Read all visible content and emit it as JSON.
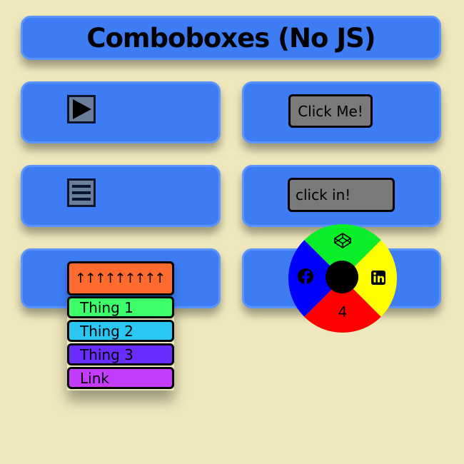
{
  "title": "Comboboxes (No JS)",
  "cards": {
    "play_icon": "play-icon",
    "menu_icon": "hamburger-menu-icon",
    "button_label": "Click Me!",
    "input_placeholder": "click in!"
  },
  "combobox": {
    "toggle_label": "↑↑↑↑↑↑↑↑↑",
    "items": [
      {
        "label": "Thing 1",
        "color": "#3dff6a"
      },
      {
        "label": "Thing 2",
        "color": "#29c7f2"
      },
      {
        "label": "Thing 3",
        "color": "#6a2dff"
      },
      {
        "label": "Link",
        "color": "#c43dff"
      }
    ],
    "toggle_color": "#ff6a2f"
  },
  "radial_menu": {
    "top": {
      "icon": "codepen-icon",
      "color": "#0aef2a"
    },
    "right": {
      "icon": "linkedin-icon",
      "color": "#ffff00"
    },
    "bottom": {
      "label": "4",
      "color": "#ff0000"
    },
    "left": {
      "icon": "facebook-icon",
      "color": "#0000ff"
    },
    "center_color": "#000000"
  },
  "colors": {
    "background": "#efe8bd",
    "panel": "#3d7cf2"
  }
}
